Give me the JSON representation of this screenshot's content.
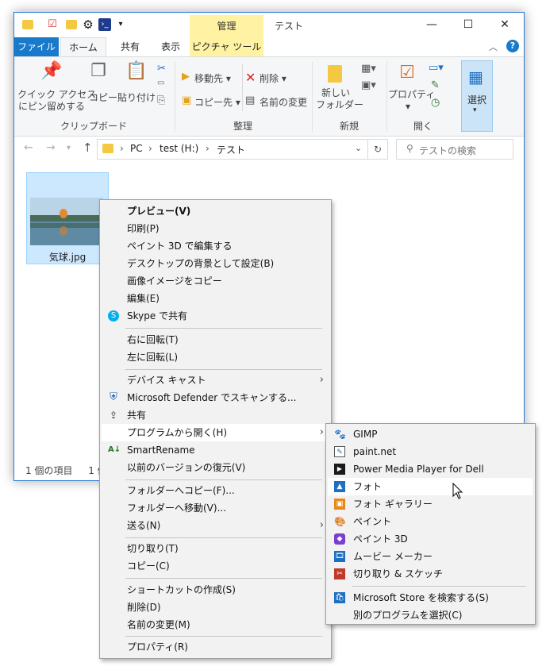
{
  "window": {
    "title": "テスト",
    "context_tab_header": "管理",
    "controls": {
      "minimize": "—",
      "maximize": "☐",
      "close": "✕"
    }
  },
  "ribbon_tabs": [
    "ファイル",
    "ホーム",
    "共有",
    "表示",
    "ピクチャ ツール"
  ],
  "ribbon": {
    "clipboard": {
      "group_label": "クリップボード",
      "pin_line1": "クイック アクセス",
      "pin_line2": "にピン留めする",
      "copy": "コピー",
      "paste": "貼り付け"
    },
    "organize": {
      "group_label": "整理",
      "move_to": "移動先",
      "copy_to": "コピー先",
      "delete": "削除",
      "rename": "名前の変更"
    },
    "new": {
      "group_label": "新規",
      "new_folder_line1": "新しい",
      "new_folder_line2": "フォルダー"
    },
    "open": {
      "group_label": "開く",
      "properties": "プロパティ"
    },
    "select": {
      "label": "選択"
    }
  },
  "address": {
    "path": [
      "PC",
      "test (H:)",
      "テスト"
    ],
    "search_placeholder": "テストの検索"
  },
  "file": {
    "name": "気球.jpg"
  },
  "status": {
    "item_count": "1 個の項目",
    "selected_truncated": "1 個"
  },
  "context_menu": {
    "items": [
      {
        "label": "プレビュー(V)"
      },
      {
        "label": "印刷(P)"
      },
      {
        "label": "ペイント 3D で編集する"
      },
      {
        "label": "デスクトップの背景として設定(B)"
      },
      {
        "label": "画像イメージをコピー"
      },
      {
        "label": "編集(E)"
      },
      {
        "label": "Skype で共有"
      },
      {
        "label": "右に回転(T)"
      },
      {
        "label": "左に回転(L)"
      },
      {
        "label": "デバイス キャスト"
      },
      {
        "label": "Microsoft Defender でスキャンする..."
      },
      {
        "label": "共有"
      },
      {
        "label": "プログラムから開く(H)"
      },
      {
        "label": "SmartRename"
      },
      {
        "label": "以前のバージョンの復元(V)"
      },
      {
        "label": "フォルダーへコピー(F)..."
      },
      {
        "label": "フォルダーへ移動(V)..."
      },
      {
        "label": "送る(N)"
      },
      {
        "label": "切り取り(T)"
      },
      {
        "label": "コピー(C)"
      },
      {
        "label": "ショートカットの作成(S)"
      },
      {
        "label": "削除(D)"
      },
      {
        "label": "名前の変更(M)"
      },
      {
        "label": "プロパティ(R)"
      }
    ]
  },
  "open_with_menu": {
    "items": [
      {
        "label": "GIMP"
      },
      {
        "label": "paint.net"
      },
      {
        "label": "Power Media Player for Dell"
      },
      {
        "label": "フォト"
      },
      {
        "label": "フォト ギャラリー"
      },
      {
        "label": "ペイント"
      },
      {
        "label": "ペイント 3D"
      },
      {
        "label": "ムービー メーカー"
      },
      {
        "label": "切り取り & スケッチ"
      },
      {
        "label": "Microsoft Store を検索する(S)"
      },
      {
        "label": "別のプログラムを選択(C)"
      }
    ]
  },
  "colors": {
    "accent": "#1979ca",
    "window_border": "#2b79d7",
    "selection": "#cce8ff",
    "manage_tab": "#fff3a3"
  }
}
